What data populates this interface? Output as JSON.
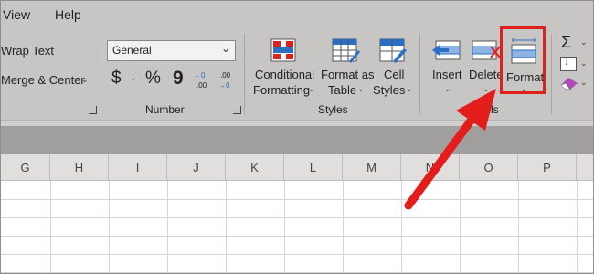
{
  "menu": {
    "view": "View",
    "help": "Help"
  },
  "alignment": {
    "wrap_text": "Wrap Text",
    "merge_center": "Merge & Center"
  },
  "number": {
    "format_value": "General",
    "currency_symbol": "$",
    "percent_symbol": "%",
    "comma_symbol": "9",
    "increase_decimal": "←0 .00",
    "decrease_decimal": ".00 →0",
    "group_label": "Number"
  },
  "styles": {
    "conditional_line1": "Conditional",
    "conditional_line2": "Formatting",
    "format_table_line1": "Format as",
    "format_table_line2": "Table",
    "cell_styles_line1": "Cell",
    "cell_styles_line2": "Styles",
    "group_label": "Styles"
  },
  "cells": {
    "insert": "Insert",
    "delete": "Delete",
    "format": "Format",
    "group_label": "Cells"
  },
  "editing": {
    "sum_symbol": "Σ"
  },
  "columns": [
    "G",
    "H",
    "I",
    "J",
    "K",
    "L",
    "M",
    "N",
    "O",
    "P"
  ],
  "colors": {
    "ribbon_bg": "#c8c6c4",
    "highlight_red": "#e0201b",
    "arrow_red": "#e31c1c",
    "icon_blue": "#2b6fc4"
  }
}
